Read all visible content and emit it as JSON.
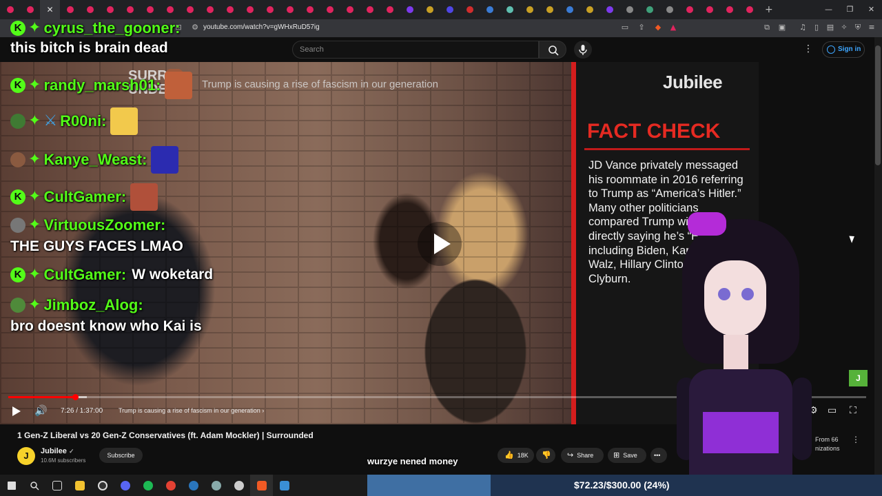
{
  "browser": {
    "url": "youtube.com/watch?v=gWHxRuD57ig",
    "tab_favicon_colors": [
      "#e0245e",
      "#e0245e",
      "#e0245e",
      "#e0245e",
      "#e0245e",
      "#e0245e",
      "#e0245e",
      "#e0245e",
      "#e0245e",
      "#e0245e",
      "#e0245e",
      "#e0245e",
      "#e0245e",
      "#e0245e",
      "#e0245e",
      "#e0245e",
      "#e0245e",
      "#e0245e",
      "#e0245e",
      "#e0245e",
      "#7c3aed",
      "#c8a024",
      "#4f46e5",
      "#d12d2d",
      "#3a7bd5",
      "#5fbfb0",
      "#c8a024",
      "#c8a024",
      "#3a7bd5",
      "#c8a024",
      "#7c3aed",
      "#888888",
      "#3fa07a",
      "#888888",
      "#e0245e",
      "#e0245e",
      "#e0245e",
      "#e0245e"
    ],
    "new_tab_glyph": "+",
    "window_controls": [
      "—",
      "❐",
      "✕"
    ]
  },
  "youtube": {
    "search_placeholder": "Search",
    "signin_label": "Sign in",
    "more_glyph": "⋮"
  },
  "video": {
    "overlay_topic": "Trump is causing a rise of fascism in our generation",
    "show_logo_text": "SURR\nUNDED",
    "channel_logo": "Jubilee",
    "fact_check_title": "FACT CHECK",
    "fact_check_text": "JD Vance privately messaged his roommate in 2016 referring to Trump as “America’s Hitler.” Many other politicians compared Trump without directly saying he’s “Hitler,” including Biden, Kamala Harris, Walz, Hillary Clinton, Jim Clyburn.",
    "progress_fraction": 0.0787,
    "current_time": "7:26",
    "duration": "1:37:00",
    "time_display": "7:26 / 1:37:00",
    "chapter": "Trump is causing a rise of fascism in our generation",
    "chapter_chevron": "›",
    "accent_color": "#ff0000"
  },
  "chat": [
    {
      "badge": "k",
      "name": "cyrus_the_gooner:",
      "message": ""
    },
    {
      "badge": "",
      "name": "",
      "message": "this bitch is brain dead"
    },
    {
      "badge": "k",
      "name": "randy_marsh01:",
      "message": "",
      "emote": "#c0603a"
    },
    {
      "badge": "frog",
      "name": "R00ni:",
      "message": "",
      "emote": "#f2c94c"
    },
    {
      "badge": "avatar",
      "name": "Kanye_Weast:",
      "message": "",
      "emote": "#2b2bb0"
    },
    {
      "badge": "k",
      "name": "CultGamer:",
      "message": "",
      "emote": "#b0503a"
    },
    {
      "badge": "avatar2",
      "name": "VirtuousZoomer:",
      "message": ""
    },
    {
      "badge": "",
      "name": "",
      "message": "THE GUYS FACES LMAO"
    },
    {
      "badge": "k",
      "name": "CultGamer:",
      "message": "W woketard"
    },
    {
      "badge": "pepe",
      "name": "Jimboz_Alog:",
      "message": ""
    },
    {
      "badge": "",
      "name": "",
      "message": "bro doesnt know who Kai is"
    }
  ],
  "chat_badge_glyphs": {
    "k": "K",
    "diamond": "✦",
    "sword": "⚔"
  },
  "page": {
    "title": "1 Gen-Z Liberal vs 20 Gen-Z Conservatives (ft. Adam Mockler) | Surrounded",
    "channel_name": "Jubilee",
    "channel_avatar": "J",
    "verified_glyph": "✓",
    "subscribers": "10.6M subscribers",
    "subscribe_label": "Subscribe",
    "like_count": "18K",
    "share_label": "Share",
    "save_label": "Save",
    "more_glyph": "•••",
    "side_from": "From 66",
    "side_from_sub": "nizations"
  },
  "donation": {
    "label": "wurzye nened money",
    "progress_text": "$72.23/$300.00 (24%)",
    "fraction": 0.24
  }
}
